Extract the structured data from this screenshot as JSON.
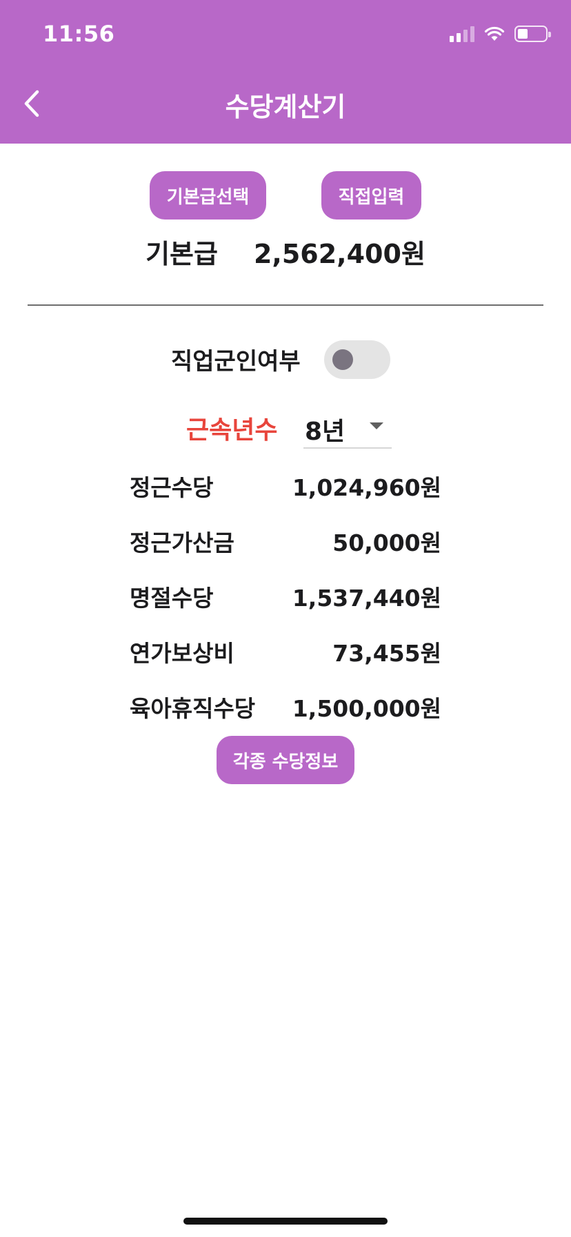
{
  "status_bar": {
    "time": "11:56"
  },
  "header": {
    "title": "수당계산기",
    "back_icon": "chevron-left-icon"
  },
  "buttons": {
    "select_base": "기본급선택",
    "direct_input": "직접입력",
    "allowance_info": "각종 수당정보"
  },
  "base_pay": {
    "label": "기본급",
    "value": "2,562,400원"
  },
  "job_group": {
    "label": "직업군인여부",
    "enabled": false
  },
  "service_years": {
    "label": "근속년수",
    "value": "8년"
  },
  "allowances": [
    {
      "label": "정근수당",
      "value": "1,024,960원"
    },
    {
      "label": "정근가산금",
      "value": "50,000원"
    },
    {
      "label": "명절수당",
      "value": "1,537,440원"
    },
    {
      "label": "연가보상비",
      "value": "73,455원"
    },
    {
      "label": "육아휴직수당",
      "value": "1,500,000원"
    }
  ],
  "colors": {
    "primary": "#b868c8",
    "accent_red": "#e8453c",
    "toggle_track": "#e4e4e4"
  }
}
